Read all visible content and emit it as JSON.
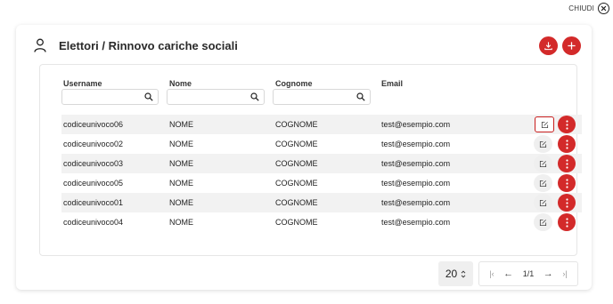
{
  "close": {
    "label": "CHIUDI"
  },
  "header": {
    "title": "Elettori / Rinnovo cariche sociali"
  },
  "table": {
    "columns": [
      "Username",
      "Nome",
      "Cognome",
      "Email"
    ],
    "rows": [
      [
        "codiceunivoco06",
        "NOME",
        "COGNOME",
        "test@esempio.com"
      ],
      [
        "codiceunivoco02",
        "NOME",
        "COGNOME",
        "test@esempio.com"
      ],
      [
        "codiceunivoco03",
        "NOME",
        "COGNOME",
        "test@esempio.com"
      ],
      [
        "codiceunivoco05",
        "NOME",
        "COGNOME",
        "test@esempio.com"
      ],
      [
        "codiceunivoco01",
        "NOME",
        "COGNOME",
        "test@esempio.com"
      ],
      [
        "codiceunivoco04",
        "NOME",
        "COGNOME",
        "test@esempio.com"
      ]
    ]
  },
  "pagination": {
    "page_size": "20",
    "page_info": "1/1"
  },
  "colors": {
    "accent": "#d32a2a",
    "highlight_border": "#c81e1e",
    "stripe": "#f2f2f2"
  },
  "icons": [
    "close-icon",
    "user-icon",
    "download-icon",
    "plus-icon",
    "search-icon",
    "edit-icon",
    "more-vertical-icon",
    "first-page-icon",
    "prev-page-icon",
    "next-page-icon",
    "last-page-icon",
    "sort-icon"
  ]
}
